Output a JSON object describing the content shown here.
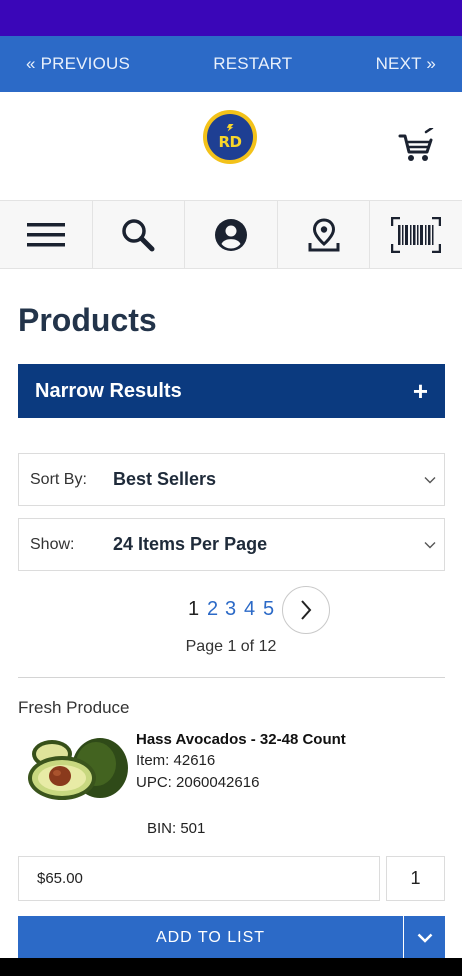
{
  "nav": {
    "previous_label": "« PREVIOUS",
    "restart_label": "RESTART",
    "next_label": "NEXT »"
  },
  "header": {
    "logo_text": "RD",
    "cart_icon": "shopping-cart-icon"
  },
  "icon_bar": {
    "items": [
      {
        "icon": "menu-icon"
      },
      {
        "icon": "search-icon"
      },
      {
        "icon": "account-icon"
      },
      {
        "icon": "location-icon"
      },
      {
        "icon": "barcode-scan-icon"
      }
    ]
  },
  "page": {
    "title": "Products"
  },
  "filters": {
    "narrow_label": "Narrow Results",
    "narrow_toggle": "+",
    "sort_label": "Sort By:",
    "sort_value": "Best Sellers",
    "show_label": "Show:",
    "show_value": "24 Items Per Page"
  },
  "pagination": {
    "pages": [
      "1",
      "2",
      "3",
      "4",
      "5"
    ],
    "current": "1",
    "info": "Page 1 of 12"
  },
  "product": {
    "category": "Fresh Produce",
    "name": "Hass Avocados - 32-48 Count",
    "item": "Item: 42616",
    "upc": "UPC: 2060042616",
    "bin": "BIN: 501",
    "price": "$65.00",
    "quantity": "1",
    "add_label": "ADD TO LIST"
  },
  "colors": {
    "status_bar": "#3a06b8",
    "nav_bar": "#2c6ac7",
    "narrow_bg": "#0b3a7f",
    "button": "#2c6ac7",
    "title": "#23344a"
  }
}
